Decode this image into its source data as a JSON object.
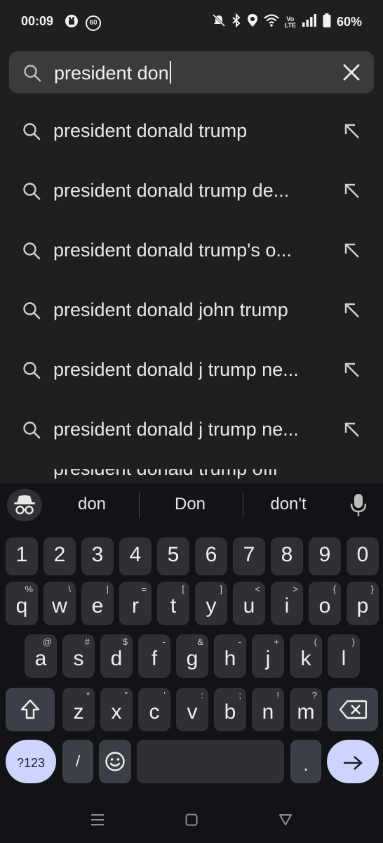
{
  "status_bar": {
    "time": "00:09",
    "badge": "60",
    "battery": "60%"
  },
  "search": {
    "query": "president don"
  },
  "suggestions": [
    {
      "text": "president donald trump"
    },
    {
      "text": "president donald trump de..."
    },
    {
      "text": "president donald trump's o..."
    },
    {
      "text": "president donald john trump"
    },
    {
      "text": "president donald j trump ne..."
    },
    {
      "text": "president donald j trump ne..."
    }
  ],
  "partial_suggestion": "president donald trump offi",
  "keyboard": {
    "predictions": [
      "don",
      "Don",
      "don't"
    ],
    "number_row": [
      "1",
      "2",
      "3",
      "4",
      "5",
      "6",
      "7",
      "8",
      "9",
      "0"
    ],
    "row1": [
      {
        "key": "q",
        "alt": "%"
      },
      {
        "key": "w",
        "alt": "\\"
      },
      {
        "key": "e",
        "alt": "|"
      },
      {
        "key": "r",
        "alt": "="
      },
      {
        "key": "t",
        "alt": "["
      },
      {
        "key": "y",
        "alt": "]"
      },
      {
        "key": "u",
        "alt": "<"
      },
      {
        "key": "i",
        "alt": ">"
      },
      {
        "key": "o",
        "alt": "{"
      },
      {
        "key": "p",
        "alt": "}"
      }
    ],
    "row2": [
      {
        "key": "a",
        "alt": "@"
      },
      {
        "key": "s",
        "alt": "#"
      },
      {
        "key": "d",
        "alt": "$"
      },
      {
        "key": "f",
        "alt": "-"
      },
      {
        "key": "g",
        "alt": "&"
      },
      {
        "key": "h",
        "alt": "-"
      },
      {
        "key": "j",
        "alt": "+"
      },
      {
        "key": "k",
        "alt": "("
      },
      {
        "key": "l",
        "alt": ")"
      }
    ],
    "row3": [
      {
        "key": "z",
        "alt": "*"
      },
      {
        "key": "x",
        "alt": "\""
      },
      {
        "key": "c",
        "alt": "'"
      },
      {
        "key": "v",
        "alt": ":"
      },
      {
        "key": "b",
        "alt": ";"
      },
      {
        "key": "n",
        "alt": "!"
      },
      {
        "key": "m",
        "alt": "?"
      }
    ],
    "symbols_label": "?123",
    "slash_label": "/",
    "period_label": "."
  },
  "colors": {
    "background": "#1f1f1f",
    "search_bar": "#3b3b3b",
    "keyboard_bg": "#111317",
    "key": "#2e3033",
    "accent_key": "#cdd5ff"
  },
  "icons": {
    "search": "search-icon",
    "clear": "close-icon",
    "fill_suggestion": "arrow-up-left-icon",
    "incognito": "incognito-icon",
    "microphone": "mic-icon",
    "shift": "shift-icon",
    "backspace": "backspace-icon",
    "emoji": "emoji-icon",
    "enter": "arrow-right-icon"
  }
}
